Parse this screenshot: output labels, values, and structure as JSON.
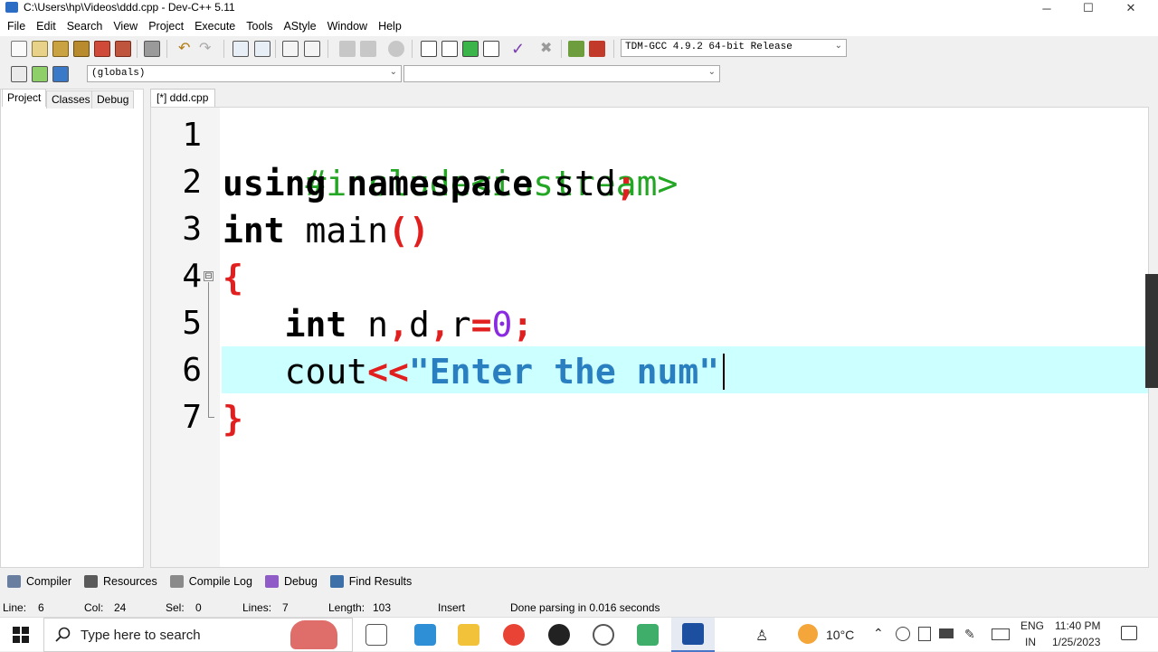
{
  "window": {
    "title": "C:\\Users\\hp\\Videos\\ddd.cpp - Dev-C++ 5.11",
    "controls": [
      "─",
      "☐",
      "✕"
    ]
  },
  "menu": [
    "File",
    "Edit",
    "Search",
    "View",
    "Project",
    "Execute",
    "Tools",
    "AStyle",
    "Window",
    "Help"
  ],
  "toolbar": {
    "compiler_select": "TDM-GCC 4.9.2 64-bit Release",
    "scope_select": "(globals)",
    "function_select": ""
  },
  "left_tabs": [
    "Project",
    "Classes",
    "Debug"
  ],
  "editor": {
    "file_tab": "[*] ddd.cpp",
    "line_numbers": [
      "1",
      "2",
      "3",
      "4",
      "5",
      "6",
      "7"
    ],
    "lines": {
      "l1": "#include<iostream>",
      "l2_kw1": "using",
      "l2_kw2": "namespace",
      "l2_id": "std",
      "l2_sym": ";",
      "l3_kw": "int",
      "l3_id": "main",
      "l3_sym": "()",
      "l4_sym": "{",
      "l5_kw": "int",
      "l5_a": "n",
      "l5_s1": ",",
      "l5_b": "d",
      "l5_s2": ",",
      "l5_c": "r",
      "l5_s3": "=",
      "l5_num": "0",
      "l5_s4": ";",
      "l6_id": "cout",
      "l6_sym": "<<",
      "l6_str": "\"Enter the num\"",
      "l7_sym": "}"
    },
    "fold_marker": "⊟"
  },
  "bottom_tabs": [
    "Compiler",
    "Resources",
    "Compile Log",
    "Debug",
    "Find Results"
  ],
  "status": {
    "line_label": "Line:",
    "line_value": "6",
    "col_label": "Col:",
    "col_value": "24",
    "sel_label": "Sel:",
    "sel_value": "0",
    "lines_label": "Lines:",
    "lines_value": "7",
    "length_label": "Length:",
    "length_value": "103",
    "mode": "Insert",
    "message": "Done parsing in 0.016 seconds"
  },
  "taskbar": {
    "search_placeholder": "Type here to search",
    "temperature": "10°C",
    "language": "ENG",
    "region": "IN",
    "time": "11:40 PM",
    "date": "1/25/2023"
  },
  "colors": {
    "preprocessor": "#23a623",
    "symbol": "#e21f1f",
    "number": "#8a2be2",
    "string": "#2a7fc0",
    "current_line": "#ccffff"
  }
}
